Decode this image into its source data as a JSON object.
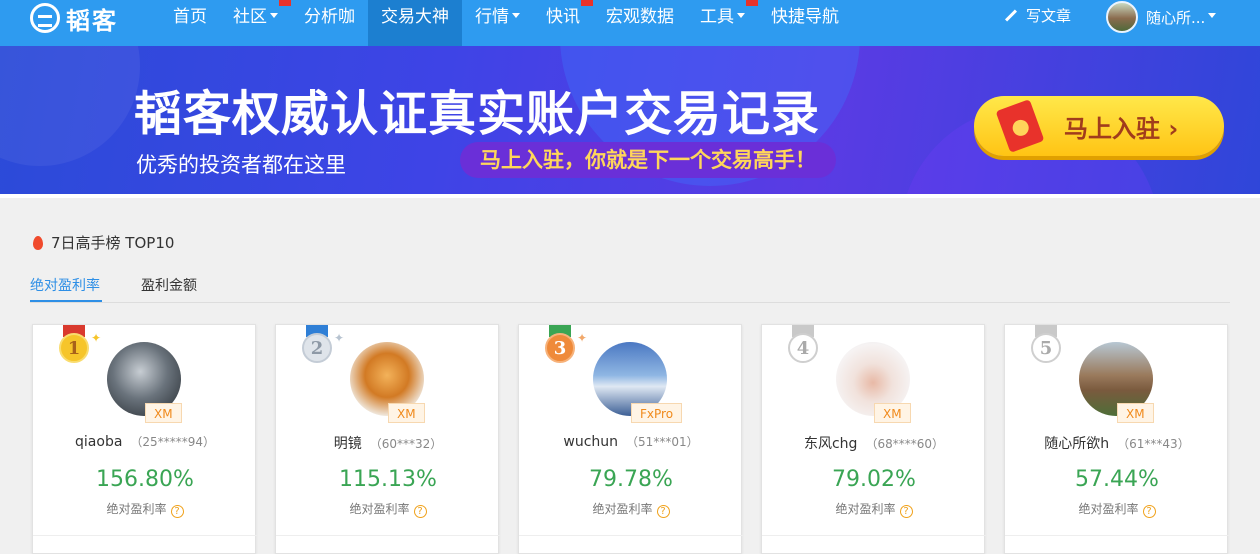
{
  "nav": {
    "logo_text": "韬客",
    "items": [
      {
        "label": "首页",
        "caret": false,
        "flag": false,
        "active": false
      },
      {
        "label": "社区",
        "caret": true,
        "flag": true,
        "active": false
      },
      {
        "label": "分析咖",
        "caret": false,
        "flag": false,
        "active": false
      },
      {
        "label": "交易大神",
        "caret": false,
        "flag": false,
        "active": true
      },
      {
        "label": "行情",
        "caret": true,
        "flag": false,
        "active": false
      },
      {
        "label": "快讯",
        "caret": false,
        "flag": true,
        "active": false
      },
      {
        "label": "宏观数据",
        "caret": false,
        "flag": false,
        "active": false
      },
      {
        "label": "工具",
        "caret": true,
        "flag": true,
        "active": false
      },
      {
        "label": "快捷导航",
        "caret": false,
        "flag": false,
        "active": false
      }
    ],
    "write_label": "写文章",
    "user_name": "随心所..."
  },
  "banner": {
    "title": "韬客权威认证真实账户交易记录",
    "subtitle": "优秀的投资者都在这里",
    "pill": "马上入驻，你就是下一个交易高手！",
    "cta": "马上入驻 ›"
  },
  "section": {
    "title": "7日高手榜 TOP10",
    "tabs": [
      "绝对盈利率",
      "盈利金额"
    ]
  },
  "cards": [
    {
      "rank": "1",
      "broker": "XM",
      "name": "qiaoba",
      "id": "（25*****94）",
      "value": "156.80%",
      "metric": "绝对盈利率",
      "medal": "gold"
    },
    {
      "rank": "2",
      "broker": "XM",
      "name": "明镜",
      "id": "（60***32）",
      "value": "115.13%",
      "metric": "绝对盈利率",
      "medal": "silver"
    },
    {
      "rank": "3",
      "broker": "FxPro",
      "name": "wuchun",
      "id": "（51***01）",
      "value": "79.78%",
      "metric": "绝对盈利率",
      "medal": "bronze"
    },
    {
      "rank": "4",
      "broker": "XM",
      "name": "东风chg",
      "id": "（68****60）",
      "value": "79.02%",
      "metric": "绝对盈利率",
      "medal": "plain"
    },
    {
      "rank": "5",
      "broker": "XM",
      "name": "随心所欲h",
      "id": "（61***43）",
      "value": "57.44%",
      "metric": "绝对盈利率",
      "medal": "plain"
    }
  ],
  "colors": {
    "nav_bg": "#2e9bf0",
    "nav_active": "#1c7fd0",
    "accent": "#2e8fe6",
    "value_green": "#3aa554",
    "broker_orange": "#f08a1c"
  },
  "icons": [
    "logo-icon",
    "caret-down-icon",
    "pen-icon",
    "fire-icon",
    "medal-icon",
    "question-icon",
    "red-envelope-icon"
  ]
}
